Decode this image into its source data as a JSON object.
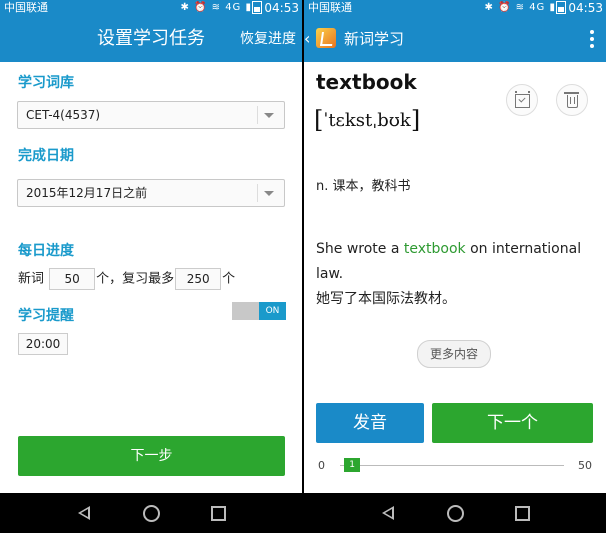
{
  "status_bar": {
    "carrier": "中国联通",
    "time": "04:53",
    "network": "4G"
  },
  "left_screen": {
    "title": "设置学习任务",
    "restore_label": "恢复进度",
    "vocab_section": "学习词库",
    "vocab_value": "CET-4(4537)",
    "date_section": "完成日期",
    "date_value": "2015年12月17日之前",
    "progress_section": "每日进度",
    "new_words_prefix": "新词",
    "new_words_value": "50",
    "review_label": "个，复习最多",
    "review_value": "250",
    "review_suffix": "个",
    "reminder_section": "学习提醒",
    "toggle_label": "ON",
    "reminder_time": "20:00",
    "next_label": "下一步"
  },
  "right_screen": {
    "back_glyph": "‹",
    "title": "新词学习",
    "word": "textbook",
    "phonetic": "ˈtɛkstˌbʊk",
    "definition": "n. 课本，教科书",
    "example_before": "She wrote a ",
    "example_highlight": "textbook",
    "example_after": " on international law.",
    "example_translation": "她写了本国际法教材。",
    "more_label": "更多内容",
    "speak_label": "发音",
    "next_word_label": "下一个",
    "progress": {
      "min": "0",
      "current": 1,
      "max": "50"
    }
  },
  "colors": {
    "primary_blue": "#1a8ac8",
    "section_blue": "#1a9acb",
    "green": "#2ca62f",
    "highlight_green": "#2e9a32"
  }
}
